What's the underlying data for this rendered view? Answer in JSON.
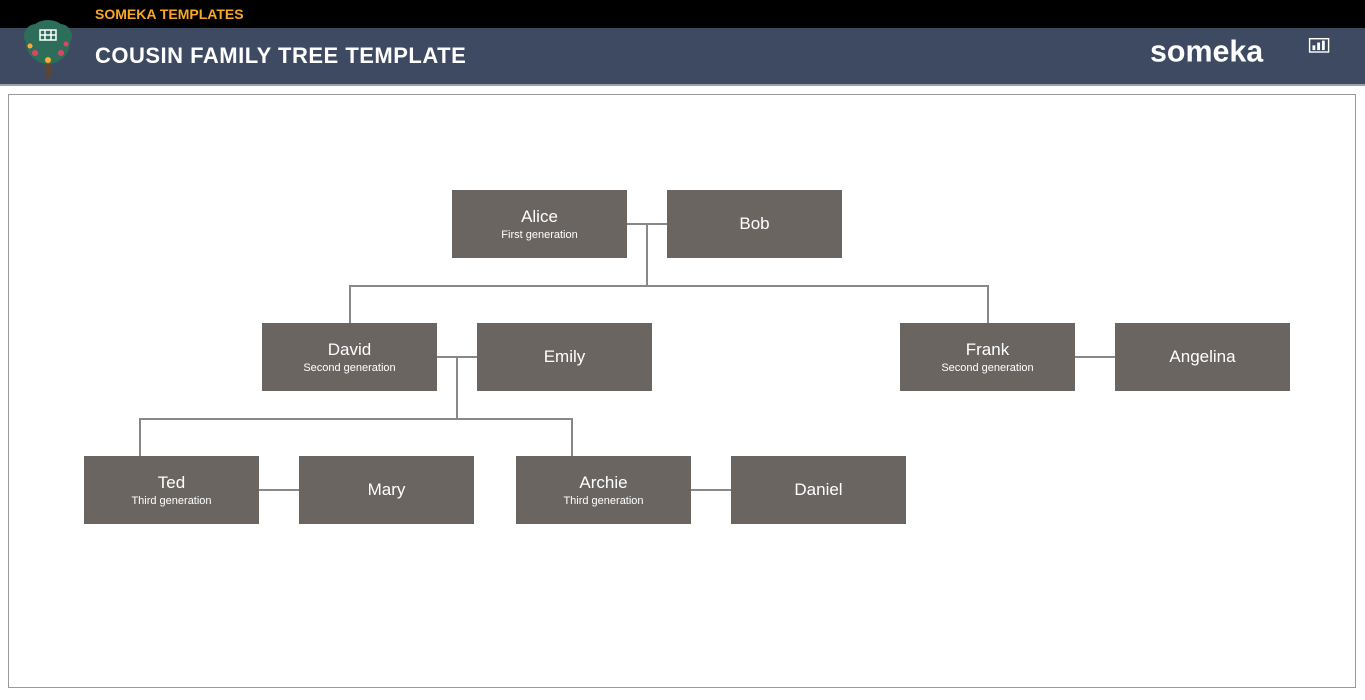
{
  "topbar": {
    "label": "SOMEKA TEMPLATES"
  },
  "header": {
    "title": "COUSIN FAMILY TREE TEMPLATE",
    "brand": "someka"
  },
  "nodes": {
    "alice": {
      "name": "Alice",
      "sub": "First generation"
    },
    "bob": {
      "name": "Bob"
    },
    "david": {
      "name": "David",
      "sub": "Second generation"
    },
    "emily": {
      "name": "Emily"
    },
    "frank": {
      "name": "Frank",
      "sub": "Second generation"
    },
    "angelina": {
      "name": "Angelina"
    },
    "ted": {
      "name": "Ted",
      "sub": "Third generation"
    },
    "mary": {
      "name": "Mary"
    },
    "archie": {
      "name": "Archie",
      "sub": "Third generation"
    },
    "daniel": {
      "name": "Daniel"
    }
  }
}
